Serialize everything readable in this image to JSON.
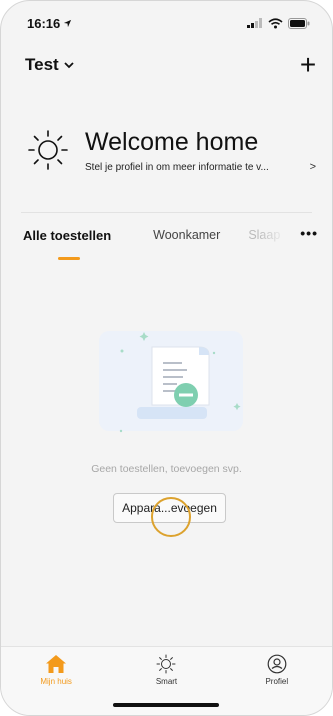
{
  "status_bar": {
    "time": "16:16"
  },
  "header": {
    "home_name": "Test",
    "add_label": "+"
  },
  "welcome": {
    "title": "Welcome home",
    "subtitle": "Stel je profiel in om meer informatie te v...",
    "chevron": ">"
  },
  "tabs": {
    "items": [
      {
        "label": "Alle toestellen",
        "active": true
      },
      {
        "label": "Woonkamer",
        "active": false
      },
      {
        "label": "Slaap",
        "active": false
      }
    ],
    "more": "•••"
  },
  "empty_state": {
    "message": "Geen toestellen, toevoegen svp.",
    "button_label": "Appara...evoegen"
  },
  "bottom_nav": {
    "items": [
      {
        "label": "Mijn huis",
        "icon": "home-icon",
        "active": true
      },
      {
        "label": "Smart",
        "icon": "sun-icon",
        "active": false
      },
      {
        "label": "Profiel",
        "icon": "profile-icon",
        "active": false
      }
    ]
  },
  "colors": {
    "accent": "#f39a1c",
    "background": "#f4f4f4",
    "touch_indicator": "#dca22e"
  }
}
